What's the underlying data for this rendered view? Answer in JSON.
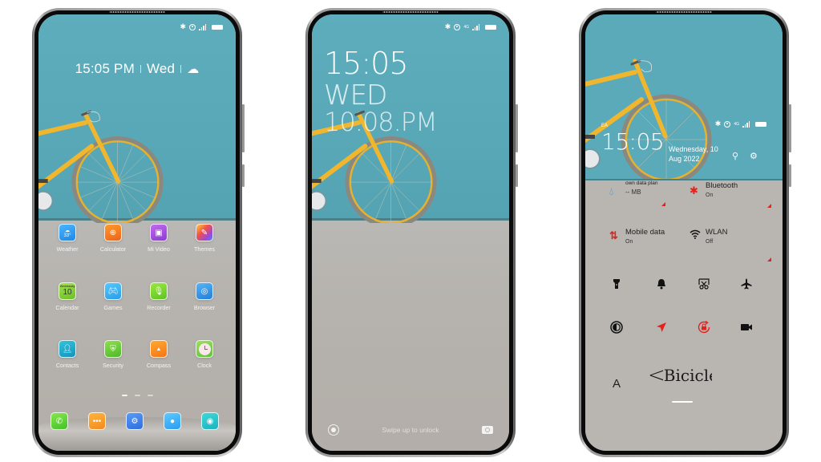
{
  "status_bar": {
    "bluetooth_icon": "bluetooth-icon",
    "signal_label": "4G",
    "battery_icon": "battery-full-icon"
  },
  "home_screen": {
    "clock": {
      "time": "15:05 PM",
      "day": "Wed",
      "weather_icon": "cloudy-weather-icon"
    },
    "apps": [
      {
        "label": "Weather",
        "icon": "weather-icon",
        "badge": "33°",
        "color": "#2e9ef0"
      },
      {
        "label": "Calculator",
        "icon": "calculator-icon",
        "color": "#f07a1c"
      },
      {
        "label": "Mi Video",
        "icon": "video-icon",
        "color": "#a64bd8"
      },
      {
        "label": "Themes",
        "icon": "themes-icon",
        "color": "#e84b7a"
      },
      {
        "label": "Calendar",
        "icon": "calendar-icon",
        "badge_top": "Wednesday",
        "badge": "10",
        "color": "#8bd23a"
      },
      {
        "label": "Games",
        "icon": "gamepad-icon",
        "color": "#37b6f2"
      },
      {
        "label": "Recorder",
        "icon": "microphone-icon",
        "color": "#7fd232"
      },
      {
        "label": "Browser",
        "icon": "browser-icon",
        "color": "#2f93e8"
      },
      {
        "label": "Contacts",
        "icon": "contacts-icon",
        "color": "#1eb0c8"
      },
      {
        "label": "Security",
        "icon": "shield-icon",
        "color": "#6ecb3a"
      },
      {
        "label": "Compass",
        "icon": "compass-icon",
        "color": "#f78f22"
      },
      {
        "label": "Clock",
        "icon": "clock-icon",
        "color": "#78d24a"
      }
    ],
    "page_indicator": {
      "pages": 3,
      "current": 1
    },
    "dock": [
      {
        "icon": "phone-icon",
        "color": "#5fd23b"
      },
      {
        "icon": "messages-icon",
        "color": "#f69a2a"
      },
      {
        "icon": "settings-icon",
        "color": "#3f7de8"
      },
      {
        "icon": "camera-icon",
        "color": "#3bb3f0"
      },
      {
        "icon": "camera-lens-icon",
        "color": "#2ec7c7"
      }
    ]
  },
  "lock_screen": {
    "time": "15:05",
    "day": "WED",
    "date_line": "10.08.PM",
    "swipe_hint": "Swipe up to unlock",
    "left_icon": "assistant-icon",
    "right_icon": "camera-icon"
  },
  "control_center": {
    "carrier": "EA",
    "time": "15:05",
    "date_line1": "Wednesday, 10",
    "date_line2": "Aug 2022",
    "search_icon": "search-icon",
    "settings_icon": "gear-icon",
    "tiles": [
      {
        "name": "data-usage",
        "title": "own data plan",
        "subtitle": "-- MB",
        "icon": "water-drop-icon",
        "icon_color": "#2e8fe0"
      },
      {
        "name": "bluetooth",
        "title": "Bluetooth",
        "subtitle": "On",
        "icon": "bluetooth-icon",
        "icon_color": "#e5211c"
      },
      {
        "name": "mobile-data",
        "title": "Mobile data",
        "subtitle": "On",
        "icon": "mobile-data-icon",
        "icon_color": "#e5211c"
      },
      {
        "name": "wlan",
        "title": "WLAN",
        "subtitle": "Off",
        "icon": "wifi-icon",
        "icon_color": "#111111"
      }
    ],
    "quick_toggles": [
      {
        "name": "flashlight",
        "icon": "flashlight-icon",
        "active": false
      },
      {
        "name": "silent",
        "icon": "bell-icon",
        "active": false
      },
      {
        "name": "screenshot",
        "icon": "scissors-icon",
        "active": false
      },
      {
        "name": "airplane",
        "icon": "airplane-icon",
        "active": false
      },
      {
        "name": "dark-mode",
        "icon": "contrast-icon",
        "active": false
      },
      {
        "name": "location",
        "icon": "location-arrow-icon",
        "active": true
      },
      {
        "name": "rotation-lock",
        "icon": "rotation-lock-icon",
        "active": true
      },
      {
        "name": "screen-recorder",
        "icon": "video-camera-icon",
        "active": false
      }
    ],
    "font_toggle": "A",
    "brand_text": "Bicicle",
    "accent_color": "#e5211c"
  }
}
